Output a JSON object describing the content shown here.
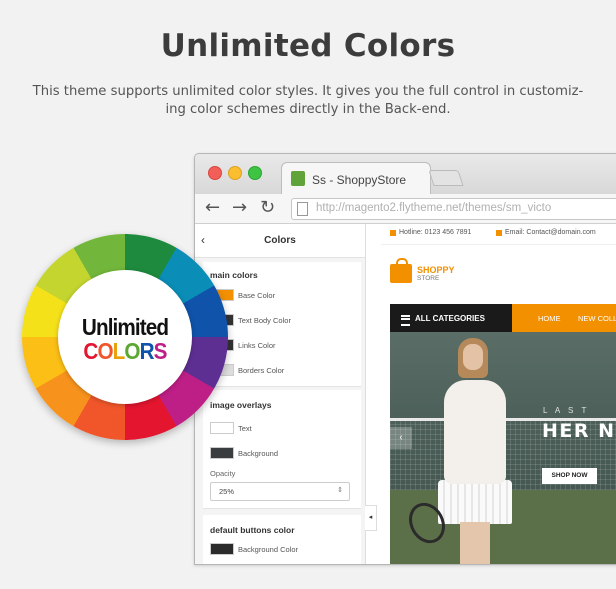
{
  "heading": "Unlimited Colors",
  "intro_line1": "This theme supports unlimited color styles. It gives you the full control in customiz-",
  "intro_line2": "ing color schemes directly in the Back-end.",
  "browser": {
    "tab_title": "Ss - ShoppyStore",
    "url": "http://magento2.flytheme.net/themes/sm_victo",
    "back_symbol": "←",
    "forward_symbol": "→",
    "reload_symbol": "↻"
  },
  "panel": {
    "back_symbol": "‹",
    "title": "Colors",
    "main_colors": {
      "title": "main colors",
      "items": [
        {
          "label": "Base Color",
          "color": "#f39000"
        },
        {
          "label": "Text Body Color",
          "color": "#333333"
        },
        {
          "label": "Links Color",
          "color": "#333333"
        },
        {
          "label": "Borders Color",
          "color": "#dddddd"
        }
      ]
    },
    "image_overlays": {
      "title": "image overlays",
      "items": [
        {
          "label": "Text",
          "color": "#ffffff"
        },
        {
          "label": "Background",
          "color": "#3a3d40"
        }
      ],
      "opacity_label": "Opacity",
      "opacity_value": "25%",
      "select_arrow": "⇕"
    },
    "default_buttons": {
      "title": "default buttons color",
      "items": [
        {
          "label": "Background Color",
          "color": "#2b2b2b"
        }
      ]
    },
    "collapse_symbol": "◂"
  },
  "site": {
    "hotline": "Hotline: 0123 456 7891",
    "email": "Email: Contact@domain.com",
    "logo_name": "SHOPPY",
    "logo_sub": "STORE",
    "all_categories": "ALL CATEGORIES",
    "menu": [
      "HOME",
      "NEW COLL"
    ],
    "hero_small": "L A S T",
    "hero_big": "HER N",
    "hero_prev": "‹",
    "shop_now": "SHOP NOW"
  },
  "badge": {
    "line1": "Unlimited",
    "line2_letters": [
      {
        "ch": "C",
        "color": "#e3152f"
      },
      {
        "ch": "O",
        "color": "#f0562a"
      },
      {
        "ch": "L",
        "color": "#e8a10c"
      },
      {
        "ch": "O",
        "color": "#5aa832"
      },
      {
        "ch": "R",
        "color": "#0f53aa"
      },
      {
        "ch": "S",
        "color": "#be1f86"
      }
    ]
  },
  "colors": {
    "accent": "#f39000",
    "dark": "#1a1a1a"
  }
}
